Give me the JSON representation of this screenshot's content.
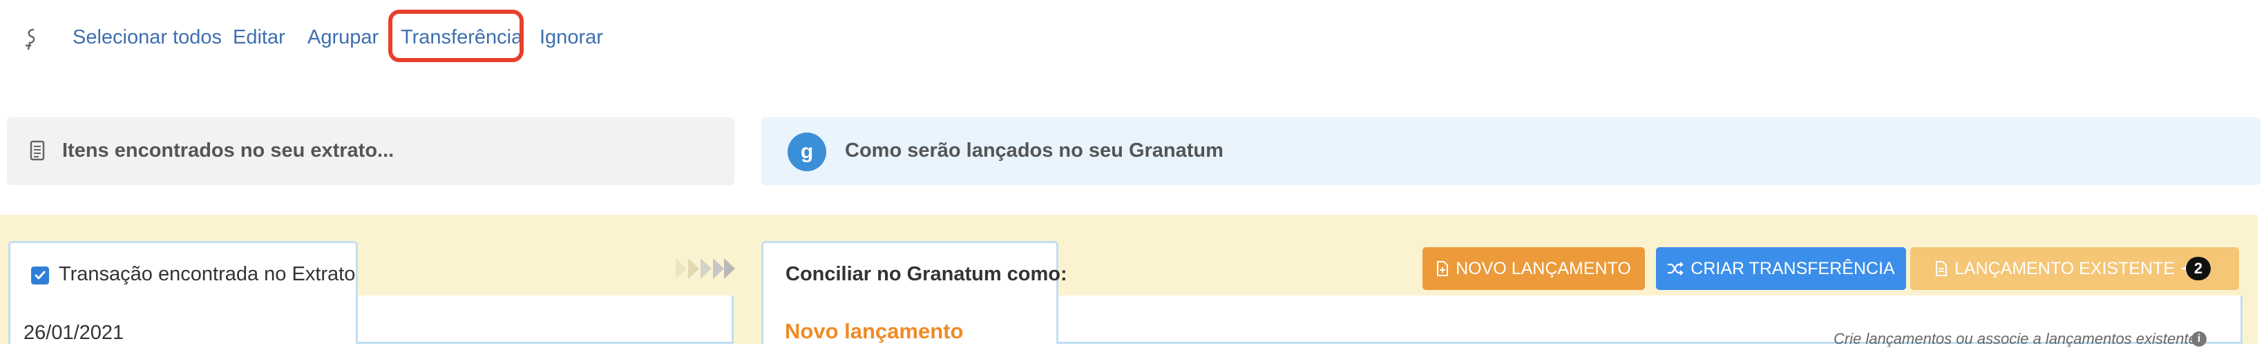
{
  "toolbar": {
    "selecionar_todos": "Selecionar todos",
    "editar": "Editar",
    "agrupar": "Agrupar",
    "transferencia": "Transferência",
    "ignorar": "Ignorar"
  },
  "panels": {
    "extrato_title": "Itens encontrados no seu extrato...",
    "granatum_title": "Como serão lançados no seu Granatum",
    "granatum_logo_letter": "g"
  },
  "left_card": {
    "tab_label": "Transação encontrada no Extrato",
    "checkbox_checked": true,
    "date": "26/01/2021"
  },
  "right_card": {
    "tab_label": "Conciliar no Granatum como:",
    "section_title": "Novo lançamento",
    "hint": "Crie lançamentos ou associe a lançamentos existentes"
  },
  "buttons": {
    "novo_lancamento": "NOVO LANÇAMENTO",
    "criar_transferencia": "CRIAR TRANSFERÊNCIA",
    "lancamento_existente": "LANÇAMENTO EXISTENTE",
    "existente_badge": "2"
  },
  "colors": {
    "link": "#3d6fb0",
    "highlight": "#e8402c",
    "orange_button": "#ec9a3a",
    "blue_button": "#3b8ee9",
    "faded_orange_button": "#f4c676",
    "section_title": "#f08a24"
  }
}
